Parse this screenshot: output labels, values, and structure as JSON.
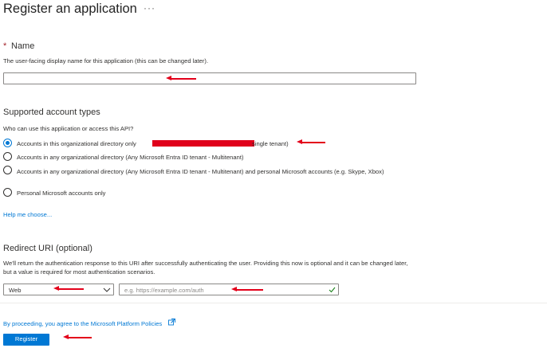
{
  "page": {
    "title": "Register an application",
    "more_glyph": "···"
  },
  "name_section": {
    "required_marker": "*",
    "heading": "Name",
    "description": "The user-facing display name for this application (this can be changed later).",
    "input_value": ""
  },
  "account_types": {
    "heading": "Supported account types",
    "question": "Who can use this application or access this API?",
    "selected_index": 0,
    "options": [
      {
        "label_prefix": "Accounts in this organizational directory only",
        "label_suffix": "single tenant)"
      },
      {
        "label": "Accounts in any organizational directory (Any Microsoft Entra ID tenant - Multitenant)"
      },
      {
        "label": "Accounts in any organizational directory (Any Microsoft Entra ID tenant - Multitenant) and personal Microsoft accounts (e.g. Skype, Xbox)"
      },
      {
        "label": "Personal Microsoft accounts only"
      }
    ],
    "help_link": "Help me choose..."
  },
  "redirect": {
    "heading": "Redirect URI (optional)",
    "description": "We'll return the authentication response to this URI after successfully authenticating the user. Providing this now is optional and it can be changed later, but a value is required for most authentication scenarios.",
    "platform_value": "Web",
    "uri_placeholder": "e.g. https://example.com/auth"
  },
  "footer": {
    "policy_text": "By proceeding, you agree to the Microsoft Platform Policies",
    "register_label": "Register"
  },
  "colors": {
    "accent": "#0078d4",
    "annotation_red": "#e3001a",
    "required_red": "#a4262c"
  },
  "icons": {
    "more": "more-icon",
    "dropdown": "chevron-down-icon",
    "valid": "checkmark-icon",
    "external": "external-link-icon"
  }
}
